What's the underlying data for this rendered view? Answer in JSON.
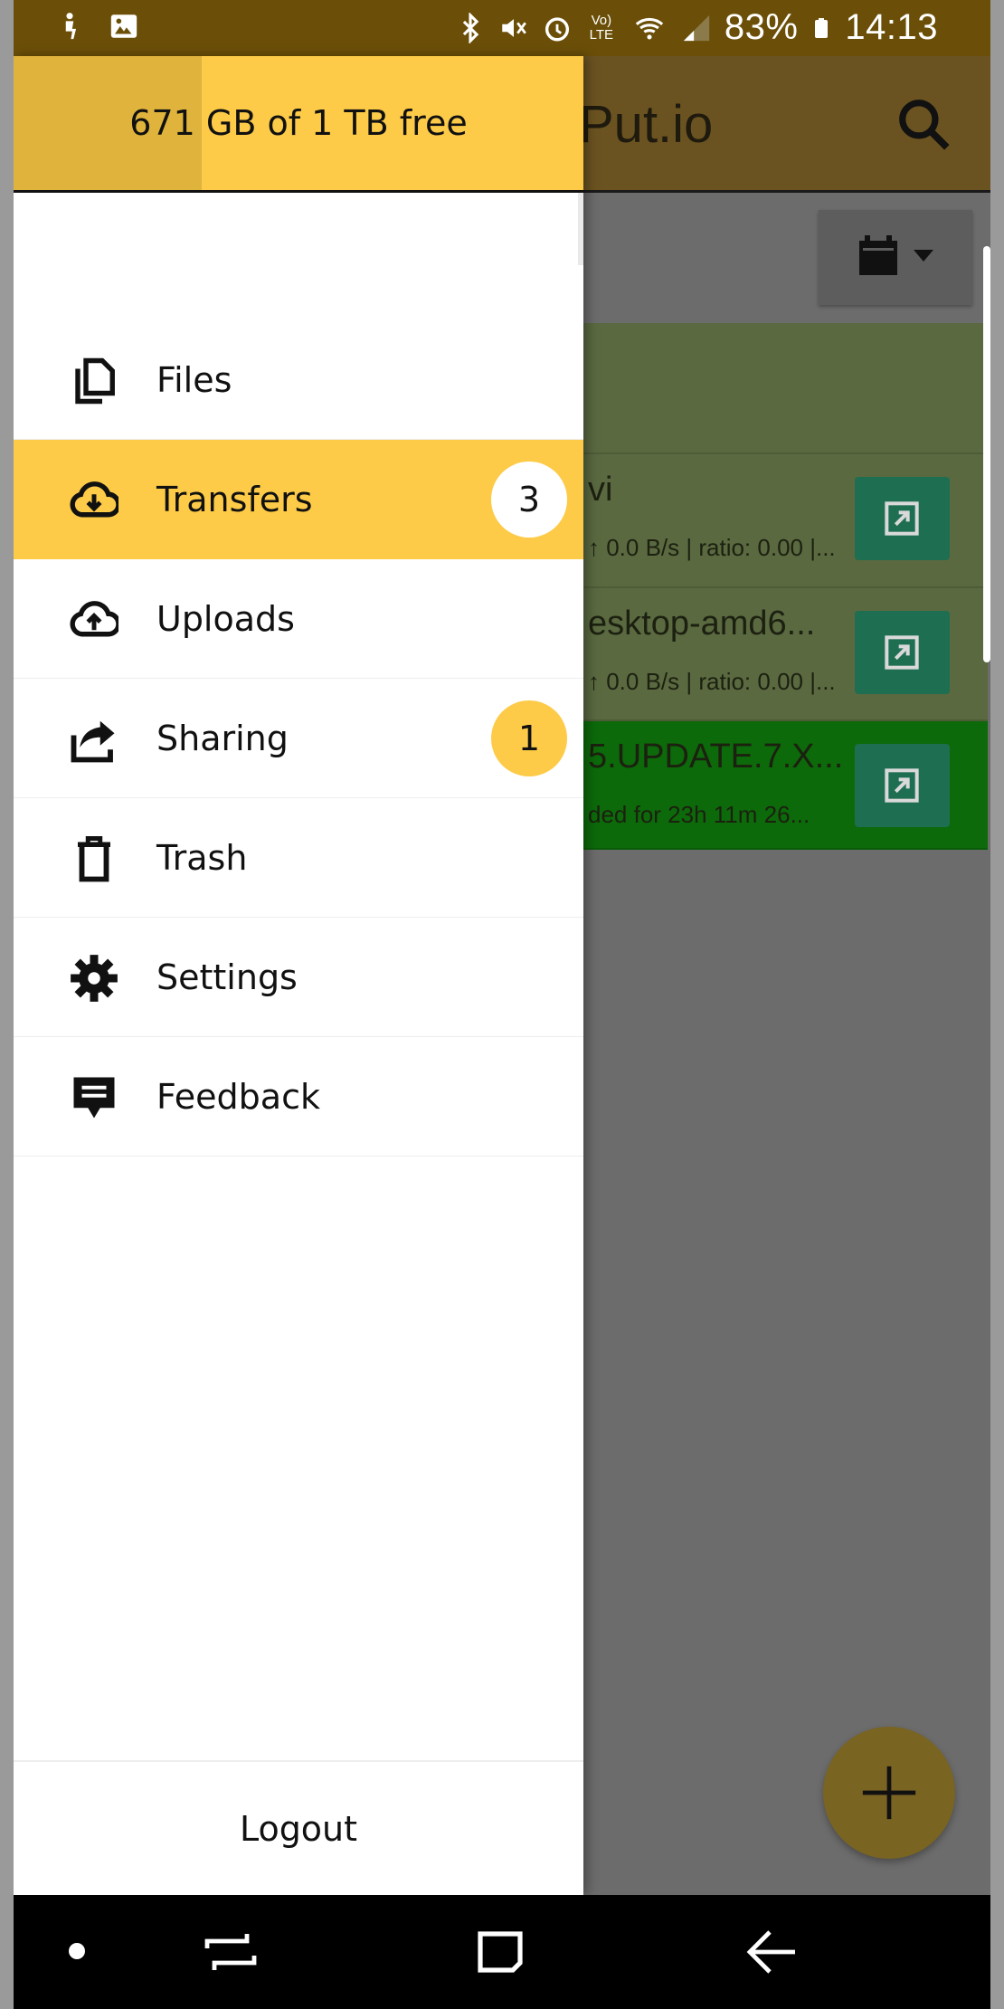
{
  "status_bar": {
    "battery": "83%",
    "time": "14:13",
    "volte_line1": "Vo)",
    "volte_line2": "LTE"
  },
  "app": {
    "title": "Put.io",
    "transfers": [
      {
        "title": "vi",
        "subtitle": "↑ 0.0 B/s | ratio: 0.00 |..."
      },
      {
        "title": "esktop-amd6...",
        "subtitle": "↑ 0.0 B/s | ratio: 0.00 |..."
      },
      {
        "title": "5.UPDATE.7.X...",
        "subtitle": "ded for 23h 11m 26..."
      }
    ]
  },
  "drawer": {
    "storage_text": "671 GB of 1 TB free",
    "storage_used_fraction": 0.33,
    "items": [
      {
        "label": "Files",
        "badge": ""
      },
      {
        "label": "Transfers",
        "badge": "3"
      },
      {
        "label": "Uploads",
        "badge": ""
      },
      {
        "label": "Sharing",
        "badge": "1"
      },
      {
        "label": "Trash",
        "badge": ""
      },
      {
        "label": "Settings",
        "badge": ""
      },
      {
        "label": "Feedback",
        "badge": ""
      }
    ],
    "active_item": "Transfers",
    "logout_label": "Logout"
  },
  "colors": {
    "accent": "#fdcb48",
    "status_bar": "#6b4f08",
    "transfer_done": "#0c6a0a",
    "action_button": "#1e6e52"
  },
  "icons": {
    "files": "files-icon",
    "transfers": "cloud-download-icon",
    "uploads": "cloud-upload-icon",
    "sharing": "share-icon",
    "trash": "trash-icon",
    "settings": "gear-icon",
    "feedback": "feedback-icon"
  }
}
